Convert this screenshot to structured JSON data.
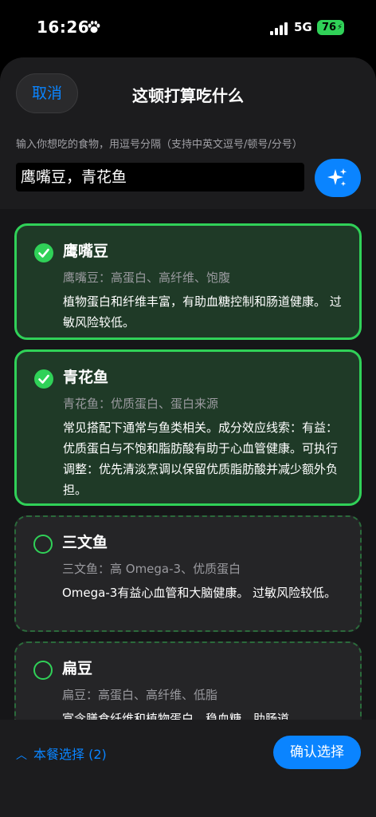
{
  "status_bar": {
    "time": "16:26",
    "network": "5G",
    "battery": "76"
  },
  "header": {
    "cancel_label": "取消",
    "title": "这顿打算吃什么",
    "hint": "输入你想吃的食物，用逗号分隔（支持中英文逗号/顿号/分号）",
    "input_value": "鹰嘴豆，青花鱼"
  },
  "foods": [
    {
      "name": "鹰嘴豆",
      "tags": "鹰嘴豆：高蛋白、高纤维、饱腹",
      "desc": "植物蛋白和纤维丰富，有助血糖控制和肠道健康。 过敏风险较低。",
      "selected": true
    },
    {
      "name": "青花鱼",
      "tags": "青花鱼：优质蛋白、蛋白来源",
      "desc": "常见搭配下通常与鱼类相关。成分效应线索：有益：优质蛋白与不饱和脂肪酸有助于心血管健康。可执行调整：优先清淡烹调以保留优质脂肪酸并减少额外负担。",
      "selected": true
    },
    {
      "name": "三文鱼",
      "tags": "三文鱼：高 Omega-3、优质蛋白",
      "desc": "Omega-3有益心血管和大脑健康。 过敏风险较低。",
      "selected": false
    },
    {
      "name": "扁豆",
      "tags": "扁豆：高蛋白、高纤维、低脂",
      "desc": "富含膳食纤维和植物蛋白，稳血糖、助肠道",
      "selected": false
    }
  ],
  "footer": {
    "meal_selection": "本餐选择 (2)",
    "confirm_label": "确认选择"
  },
  "icons": {
    "paw": "paw-icon",
    "signal": "signal-icon",
    "sparkle": "sparkle-icon",
    "check": "checkmark-icon",
    "chevron": "chevron-up-icon"
  },
  "colors": {
    "accent": "#0a84ff",
    "selected": "#30d158"
  }
}
